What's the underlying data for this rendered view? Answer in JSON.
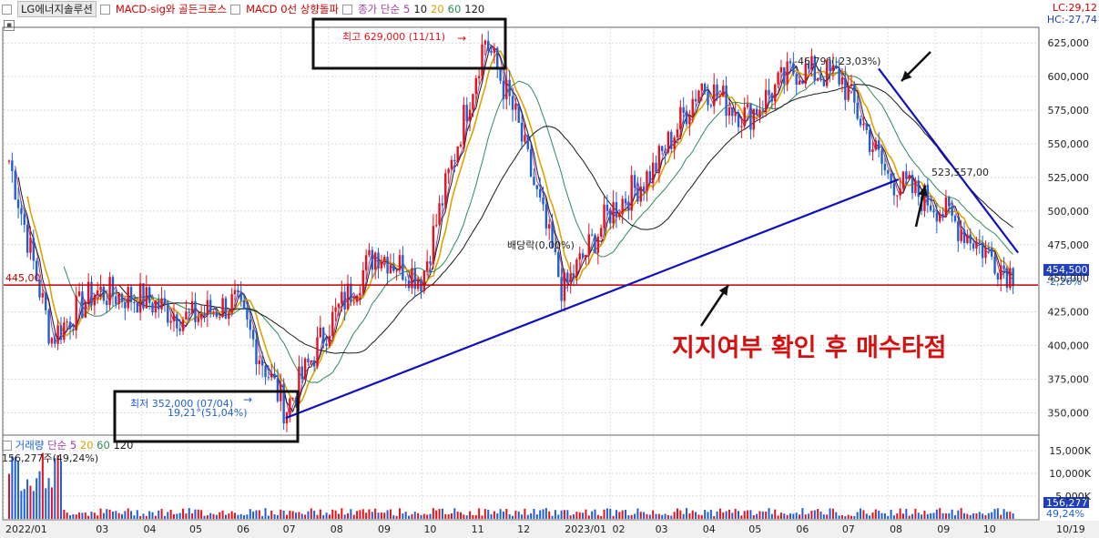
{
  "legend": {
    "stock_name": "LG에너지솔루션",
    "indicator1": "MACD-sig와 골든크로스",
    "indicator2": "MACD 0선 상향돌파",
    "ma_label": "종가 단순",
    "ma_periods": [
      "5",
      "10",
      "20",
      "60",
      "120"
    ],
    "ma_colors": [
      "#a040a0",
      "#1a1a1a",
      "#e0a000",
      "#2e8b57",
      "#1a1a1a"
    ]
  },
  "volume_legend": {
    "label": "거래량",
    "ma_label": "단순",
    "ma_periods": [
      "5",
      "20",
      "60",
      "120"
    ],
    "current": "156,277주(49,24%)"
  },
  "top_right": {
    "lc": "LC:29,12",
    "hc": "HC:-27,74"
  },
  "price_badge": {
    "price": "454,500",
    "change": "-2,26%"
  },
  "volume_badge": {
    "value": "156,277",
    "pct": "49,24%"
  },
  "colors": {
    "up": "#e8111b",
    "down": "#1f5fd6",
    "trendline": "#1010c0",
    "support": "#c00000",
    "badge": "#1f3fbf"
  },
  "annotations": {
    "high_label": "최고 629,000 (11/11)",
    "low_label1": "최저 352,000 (07/04)",
    "low_label2": "19,21°(51,04%)",
    "angle_label": "-46,79°(-23,03%)",
    "support_value": "523,557,00",
    "dividend_label": "배당락(0,00%)",
    "left_value": "445,00",
    "buy_text": "지지여부 확인 후 매수타점"
  },
  "chart_data": {
    "type": "line",
    "title": "LG에너지솔루션",
    "y_ticks": [
      "625,000",
      "600,000",
      "575,000",
      "550,000",
      "525,000",
      "500,000",
      "475,000",
      "450,000",
      "425,000",
      "400,000",
      "375,000",
      "350,000"
    ],
    "y_tick_values": [
      625000,
      600000,
      575000,
      550000,
      525000,
      500000,
      475000,
      450000,
      425000,
      400000,
      375000,
      350000
    ],
    "ylim": [
      334000,
      636000
    ],
    "x_ticks": [
      "2022/01",
      "03",
      "04",
      "05",
      "06",
      "07",
      "08",
      "09",
      "10",
      "11",
      "12",
      "2023/01",
      "02",
      "03",
      "04",
      "05",
      "06",
      "07",
      "08",
      "09",
      "10",
      "10/19"
    ],
    "volume_ticks": [
      "15,000K",
      "10,000K",
      "5,000K"
    ],
    "volume_tick_values": [
      15000,
      10000,
      5000
    ],
    "volume_ylim": [
      0,
      18000
    ],
    "series": [
      {
        "name": "종가",
        "x": [
          "2022-01",
          "2022-02",
          "2022-03",
          "2022-04",
          "2022-05",
          "2022-06",
          "2022-07-04",
          "2022-08",
          "2022-09",
          "2022-10",
          "2022-11-11",
          "2022-12",
          "2023-01",
          "2023-02",
          "2023-03",
          "2023-04",
          "2023-05",
          "2023-06",
          "2023-07",
          "2023-08",
          "2023-09",
          "2023-10-19"
        ],
        "values": [
          555000,
          405000,
          440000,
          435000,
          420000,
          432000,
          352000,
          415000,
          470000,
          450000,
          629000,
          570000,
          440000,
          500000,
          530000,
          595000,
          570000,
          605000,
          600000,
          525000,
          505000,
          454500
        ]
      }
    ],
    "support_level": 445000,
    "trendline_rising": [
      [
        "2022-07-04",
        346000
      ],
      [
        "2023-08-08",
        523557
      ]
    ],
    "trendline_falling": [
      [
        "2023-07-26",
        606000
      ],
      [
        "2023-10-25",
        469000
      ]
    ]
  }
}
